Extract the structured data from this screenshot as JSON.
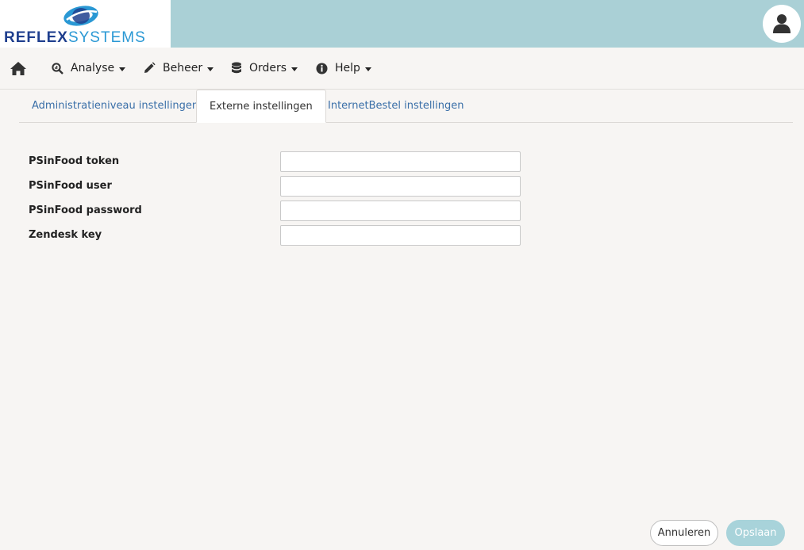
{
  "header": {
    "logo": {
      "brand_bold": "REFLEX",
      "brand_light": "SYSTEMS"
    },
    "user_icon": "user-icon"
  },
  "nav": {
    "home_icon": "home-icon",
    "items": [
      {
        "label": "Analyse",
        "icon": "magnifier-chart-icon"
      },
      {
        "label": "Beheer",
        "icon": "pencil-icon"
      },
      {
        "label": "Orders",
        "icon": "database-icon"
      },
      {
        "label": "Help",
        "icon": "info-icon"
      }
    ]
  },
  "tabs": [
    {
      "label": "Administratieniveau instellingen",
      "active": false
    },
    {
      "label": "Externe instellingen",
      "active": true
    },
    {
      "label": "InternetBestel instellingen",
      "active": false
    }
  ],
  "form": {
    "fields": [
      {
        "label": "PSinFood token",
        "value": ""
      },
      {
        "label": "PSinFood user",
        "value": ""
      },
      {
        "label": "PSinFood password",
        "value": ""
      },
      {
        "label": "Zendesk key",
        "value": ""
      }
    ]
  },
  "actions": {
    "cancel_label": "Annuleren",
    "save_label": "Opslaan"
  },
  "colors": {
    "header_bg": "#aad0d6",
    "page_bg": "#f7f5f3",
    "link": "#3a6fa8",
    "save_button": "#a8d3da"
  }
}
